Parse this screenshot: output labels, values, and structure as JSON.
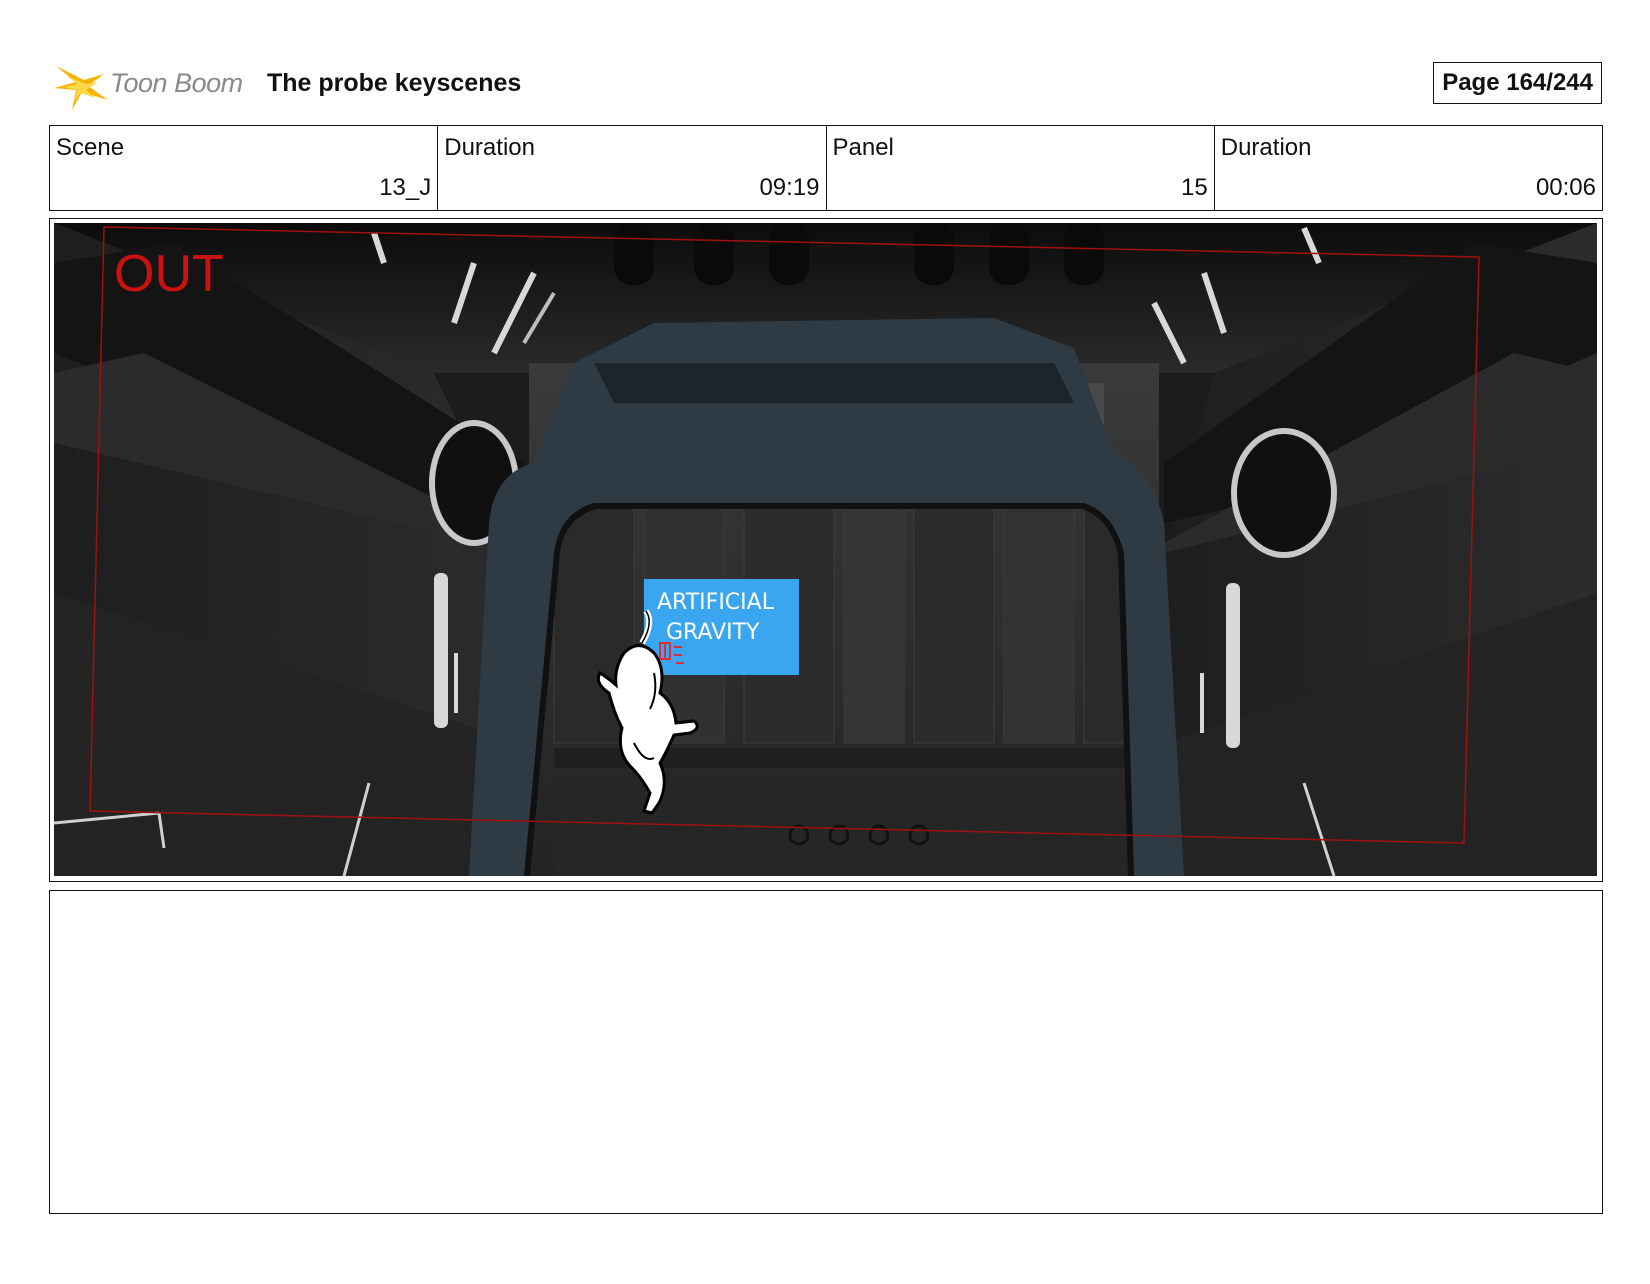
{
  "header": {
    "logo_text": "Toon Boom",
    "title": "The probe keyscenes",
    "page": "Page 164/244"
  },
  "info": {
    "scene_label": "Scene",
    "scene_value": "13_J",
    "scene_duration_label": "Duration",
    "scene_duration_value": "09:19",
    "panel_label": "Panel",
    "panel_value": "15",
    "panel_duration_label": "Duration",
    "panel_duration_value": "00:06"
  },
  "panel": {
    "annotation": "OUT",
    "sign_line1": "ARTIFICIAL",
    "sign_line2": "GRAVITY",
    "annotation_color": "#cc1111",
    "sign_color": "#3aa6f0"
  },
  "notes": {
    "text": ""
  }
}
